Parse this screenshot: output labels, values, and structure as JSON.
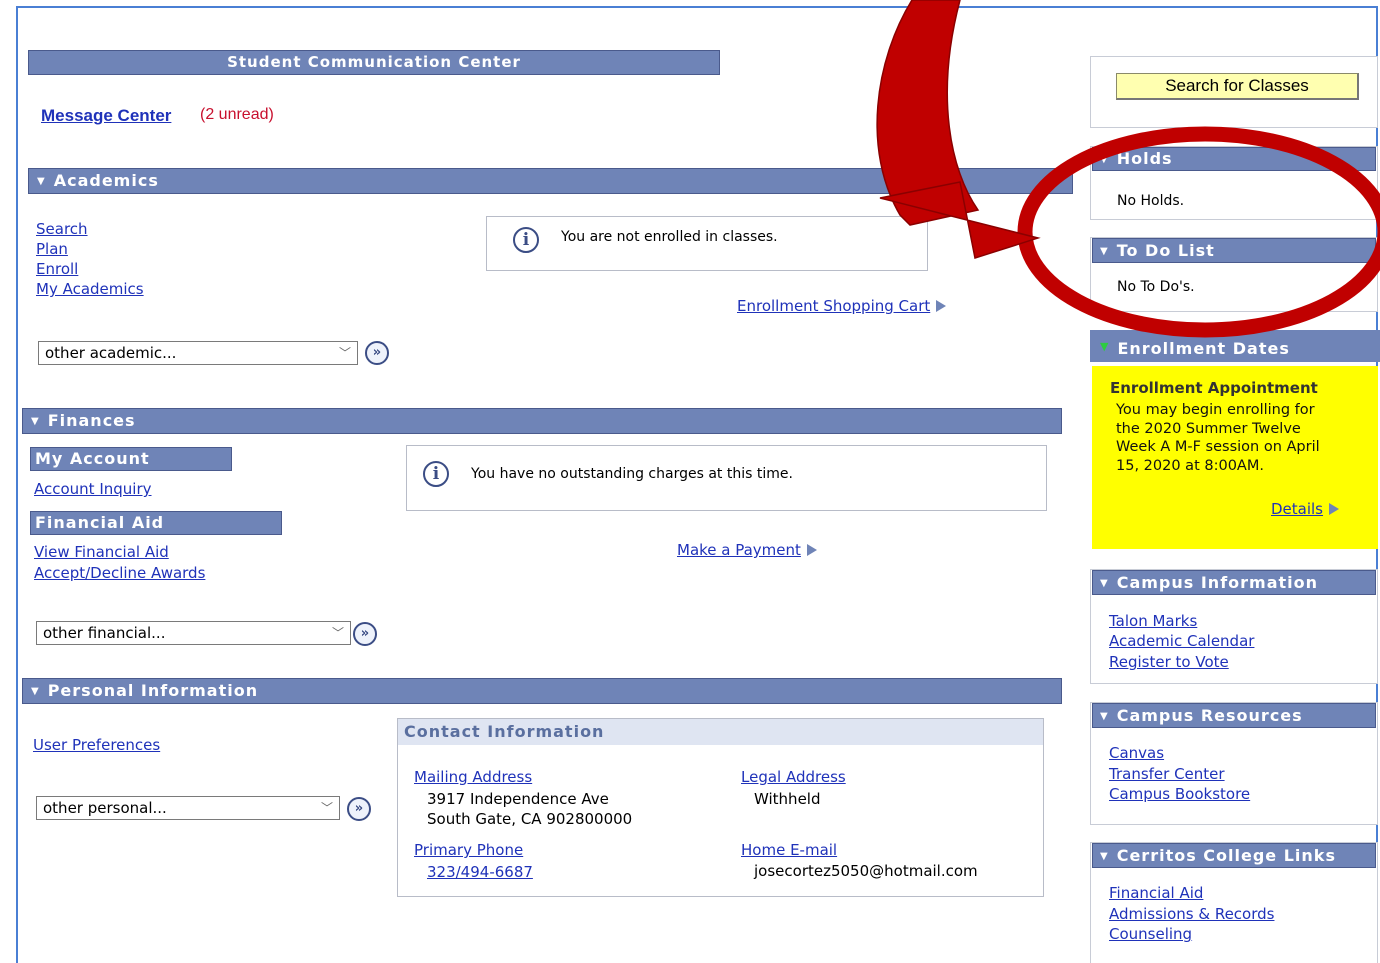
{
  "comm": {
    "title": "Student Communication Center",
    "message_center": "Message Center",
    "unread": "(2 unread)"
  },
  "academics": {
    "title": "Academics",
    "links": [
      "Search",
      "Plan",
      "Enroll",
      "My Academics"
    ],
    "info": "You are not enrolled in classes.",
    "cart_link": "Enrollment Shopping Cart",
    "select": "other academic..."
  },
  "finances": {
    "title": "Finances",
    "my_account": "My Account",
    "account_inquiry": "Account Inquiry",
    "financial_aid": "Financial Aid",
    "view_aid": "View Financial Aid",
    "accept_decline": "Accept/Decline Awards",
    "info": "You have no outstanding charges at this time.",
    "payment_link": "Make a Payment",
    "select": "other financial..."
  },
  "personal": {
    "title": "Personal Information",
    "user_prefs": "User Preferences",
    "select": "other personal...",
    "contact_title": "Contact Information",
    "mailing_label": "Mailing Address",
    "mailing_line1": "3917 Independence Ave",
    "mailing_line2": "South Gate, CA 902800000",
    "legal_label": "Legal Address",
    "legal_value": "Withheld",
    "phone_label": "Primary Phone",
    "phone_value": "323/494-6687",
    "email_label": "Home E-mail",
    "email_value": "josecortez5050@hotmail.com"
  },
  "right": {
    "search_btn": "Search for Classes",
    "holds_title": "Holds",
    "holds_text": "No Holds.",
    "todo_title": "To Do List",
    "todo_text": "No To Do's.",
    "enroll_title": "Enrollment Dates",
    "appt_title": "Enrollment Appointment",
    "appt_text": "You may begin enrolling for the 2020 Summer Twelve Week A M-F session on April 15, 2020 at 8:00AM.",
    "details": "Details",
    "campus_info_title": "Campus Information",
    "campus_info_links": [
      "Talon Marks",
      "Academic Calendar",
      "Register to Vote"
    ],
    "campus_res_title": "Campus Resources",
    "campus_res_links": [
      "Canvas",
      "Transfer Center",
      "Campus Bookstore"
    ],
    "college_links_title": "Cerritos College Links",
    "college_links": [
      "Financial Aid",
      "Admissions & Records",
      "Counseling"
    ]
  },
  "colors": {
    "header_bar": "#6f84b7",
    "link": "#1f32b9",
    "unread": "#c8102e",
    "highlight_yellow": "#ffff00",
    "annotation_red": "#c00000"
  }
}
